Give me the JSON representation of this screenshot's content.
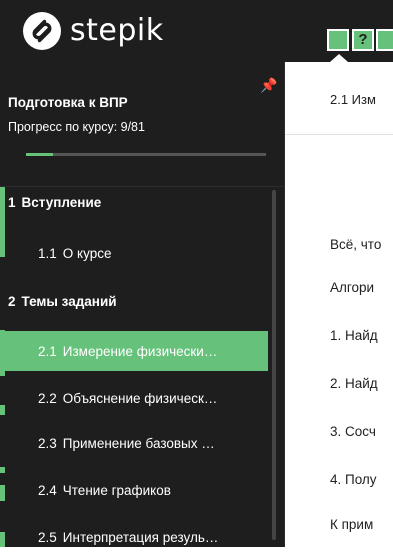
{
  "header": {
    "logo_text": "stepik",
    "step_question": "?"
  },
  "sidebar": {
    "course_title": "Подготовка к ВПР",
    "progress_label": "Прогресс по курсу:  9/81",
    "progress_fraction": 0.111,
    "sections": [
      {
        "num": "1",
        "title": "Вступление",
        "lessons": [
          {
            "num": "1.1",
            "title": "О курсе",
            "active": false
          }
        ]
      },
      {
        "num": "2",
        "title": "Темы заданий",
        "lessons": [
          {
            "num": "2.1",
            "title": "Измерение физически…",
            "active": true
          },
          {
            "num": "2.2",
            "title": "Объяснение физическ…",
            "active": false
          },
          {
            "num": "2.3",
            "title": "Применение базовых …",
            "active": false
          },
          {
            "num": "2.4",
            "title": "Чтение графиков",
            "active": false
          },
          {
            "num": "2.5",
            "title": "Интерпретация резуль…",
            "active": false
          }
        ]
      }
    ]
  },
  "content": {
    "lesson_title": "2.1 Изм",
    "lines": [
      "Всё, что",
      "Алгори",
      "1. Найд",
      "2. Найд",
      "3. Сосч",
      "4. Полу",
      "К прим"
    ]
  },
  "colors": {
    "accent": "#66c17a",
    "dark": "#1e1e1e"
  }
}
